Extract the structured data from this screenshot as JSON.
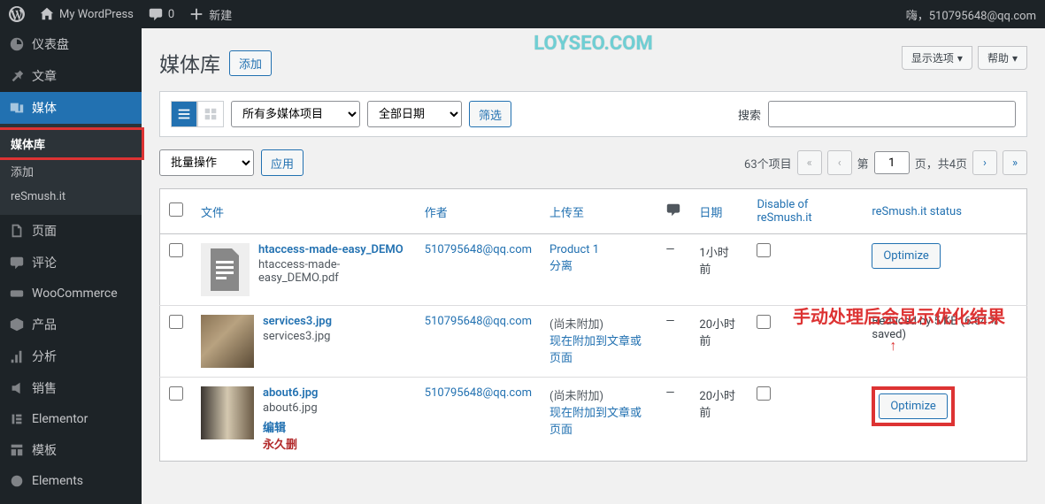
{
  "adminbar": {
    "site_title": "My WordPress",
    "comments": "0",
    "new": "新建",
    "howdy": "嗨，510795648@qq.com"
  },
  "sidebar": {
    "items": [
      {
        "label": "仪表盘"
      },
      {
        "label": "文章"
      },
      {
        "label": "媒体"
      },
      {
        "label": "页面"
      },
      {
        "label": "评论"
      },
      {
        "label": "WooCommerce"
      },
      {
        "label": "产品"
      },
      {
        "label": "分析"
      },
      {
        "label": "销售"
      },
      {
        "label": "Elementor"
      },
      {
        "label": "模板"
      },
      {
        "label": "Elements"
      }
    ],
    "submenu": [
      {
        "label": "媒体库"
      },
      {
        "label": "添加"
      },
      {
        "label": "reSmush.it"
      }
    ]
  },
  "header": {
    "title": "媒体库",
    "add_new": "添加",
    "screen_options": "显示选项",
    "help": "帮助",
    "watermark": "LOYSEO.COM"
  },
  "filters": {
    "media_type": "所有多媒体项目",
    "date": "全部日期",
    "filter_btn": "筛选",
    "search_label": "搜索"
  },
  "bulk": {
    "action": "批量操作",
    "apply": "应用"
  },
  "pagination": {
    "total_items": "63个项目",
    "current": "1",
    "page_label_pre": "第",
    "page_label_post": "页，共4页"
  },
  "columns": {
    "file": "文件",
    "author": "作者",
    "uploaded_to": "上传至",
    "date": "日期",
    "disable": "Disable of reSmush.it",
    "status": "reSmush.it status"
  },
  "annotation": "手动处理后会显示优化结果",
  "rows": [
    {
      "title": "htaccess-made-easy_DEMO",
      "filename": "htaccess-made-easy_DEMO.pdf",
      "author": "510795648@qq.com",
      "uploaded_to": "Product 1",
      "uploaded_to_sub": "分离",
      "comments": "—",
      "date": "1小时前",
      "status_btn": "Optimize",
      "thumb_type": "doc"
    },
    {
      "title": "services3.jpg",
      "filename": "services3.jpg",
      "author": "510795648@qq.com",
      "uploaded_to": "(尚未附加)",
      "uploaded_to_sub": "现在附加到文章或页面",
      "comments": "—",
      "date": "20小时前",
      "status_text": "Reduced by 5 KB (6.64 % saved)",
      "thumb_type": "img1"
    },
    {
      "title": "about6.jpg",
      "filename": "about6.jpg",
      "author": "510795648@qq.com",
      "uploaded_to": "(尚未附加)",
      "uploaded_to_sub": "现在附加到文章或页面",
      "comments": "—",
      "date": "20小时前",
      "status_btn": "Optimize",
      "thumb_type": "img2",
      "actions_edit": "编辑",
      "actions_delete": "永久删"
    }
  ]
}
